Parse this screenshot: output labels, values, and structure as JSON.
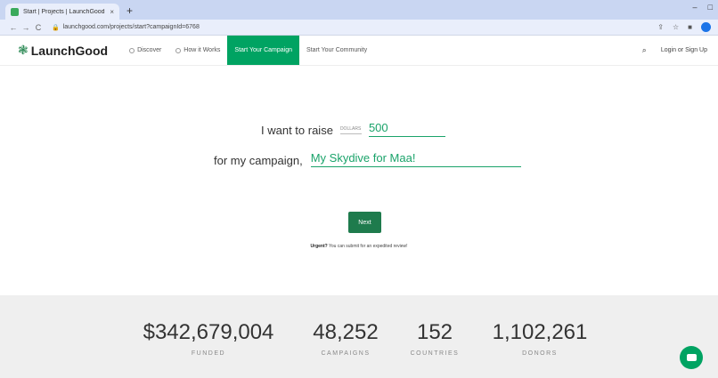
{
  "browser": {
    "tab_title": "Start | Projects | LaunchGood",
    "tab_close": "×",
    "new_tab": "+",
    "url": "launchgood.com/projects/start?campaignId=6768",
    "lock": "🔒",
    "back": "←",
    "forward": "→",
    "reload": "C",
    "minimize": "–",
    "maximize": "□",
    "share": "⇪",
    "star": "☆",
    "ext": "■"
  },
  "header": {
    "logo": "LaunchGood",
    "logo_mark": "❃",
    "nav": [
      "Discover",
      "How it Works",
      "Start Your Campaign",
      "Start Your Community"
    ],
    "search_icon": "⌕",
    "login": "Login or Sign Up"
  },
  "form": {
    "raise_label": "I want to raise",
    "currency": "DOLLARS",
    "amount": "500",
    "campaign_label": "for my campaign,",
    "campaign_name": "My Skydive for Maa!",
    "next": "Next",
    "urgent_bold": "Urgent?",
    "urgent_text": "You can submit for an expedited review!"
  },
  "stats": [
    {
      "value": "$342,679,004",
      "label": "FUNDED"
    },
    {
      "value": "48,252",
      "label": "CAMPAIGNS"
    },
    {
      "value": "152",
      "label": "COUNTRIES"
    },
    {
      "value": "1,102,261",
      "label": "DONORS"
    }
  ]
}
